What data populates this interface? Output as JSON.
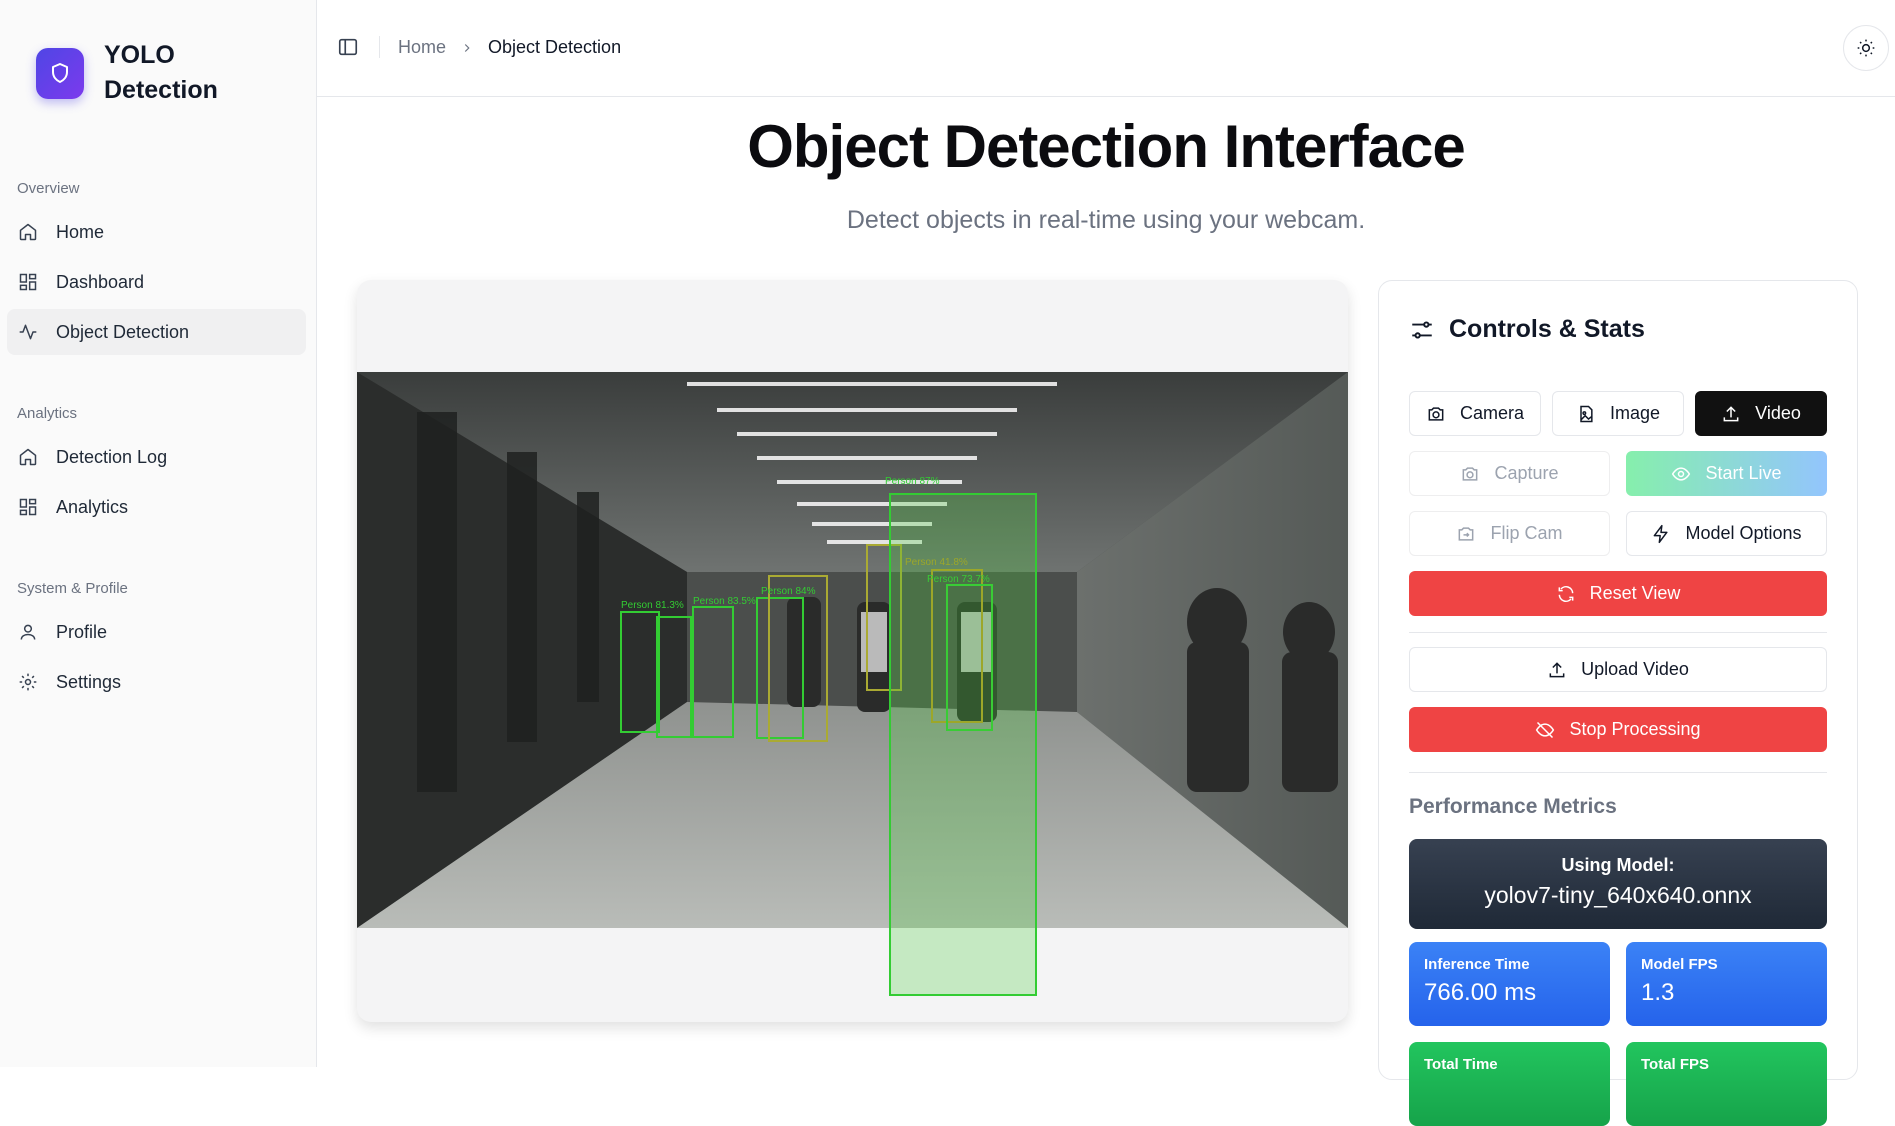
{
  "brand": {
    "line1": "YOLO",
    "line2": "Detection"
  },
  "sidebar": {
    "sections": [
      {
        "title": "Overview",
        "items": [
          {
            "label": "Home",
            "icon": "home-icon"
          },
          {
            "label": "Dashboard",
            "icon": "grid-icon"
          },
          {
            "label": "Object Detection",
            "icon": "activity-icon",
            "active": true
          }
        ]
      },
      {
        "title": "Analytics",
        "items": [
          {
            "label": "Detection Log",
            "icon": "home-icon"
          },
          {
            "label": "Analytics",
            "icon": "grid-icon"
          }
        ]
      },
      {
        "title": "System & Profile",
        "items": [
          {
            "label": "Profile",
            "icon": "user-icon"
          },
          {
            "label": "Settings",
            "icon": "gear-icon"
          }
        ]
      }
    ]
  },
  "header": {
    "breadcrumb_home": "Home",
    "breadcrumb_current": "Object Detection"
  },
  "main": {
    "title": "Object Detection Interface",
    "subtitle": "Detect objects in real-time using your webcam."
  },
  "detections": [
    {
      "label": "Person 87%"
    },
    {
      "label": "Person 41.8%"
    },
    {
      "label": "Person 73.7%"
    },
    {
      "label": "Person 84%"
    },
    {
      "label": "Person 81.3%"
    },
    {
      "label": "Person 83.5%"
    }
  ],
  "controls": {
    "title": "Controls & Stats",
    "source_camera": "Camera",
    "source_image": "Image",
    "source_video": "Video",
    "capture": "Capture",
    "start_live": "Start Live",
    "flip_cam": "Flip Cam",
    "model_options": "Model Options",
    "reset_view": "Reset View",
    "upload_video": "Upload Video",
    "stop_processing": "Stop Processing"
  },
  "metrics": {
    "title": "Performance Metrics",
    "model_label": "Using Model:",
    "model_name": "yolov7-tiny_640x640.onnx",
    "inference_label": "Inference Time",
    "inference_value": "766.00 ms",
    "fps_label": "Model FPS",
    "fps_value": "1.3",
    "total_time_label": "Total Time",
    "total_fps_label": "Total FPS"
  },
  "colors": {
    "accent": "#4f46e5",
    "danger": "#ef4444",
    "blue": "#2563eb",
    "green": "#16a34a",
    "box": "#33cc33"
  }
}
